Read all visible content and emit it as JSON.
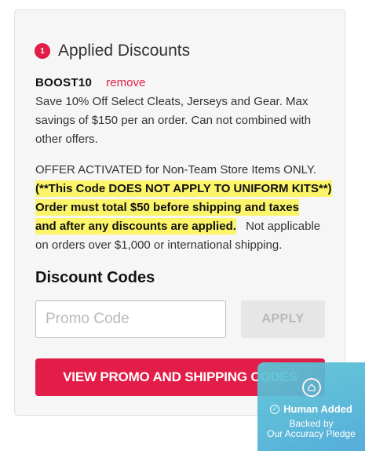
{
  "applied": {
    "count": "1",
    "title": "Applied Discounts",
    "code": "BOOST10",
    "remove_label": "remove",
    "description": "Save 10% Off Select Cleats, Jerseys and Gear. Max savings of $150 per an order. Can not combined with other offers.",
    "offer_plain": "OFFER ACTIVATED for Non-Team Store Items ONLY.",
    "offer_highlight_1": "(**This Code DOES NOT APPLY TO UNIFORM KITS**)",
    "offer_highlight_2": "Order must total $50 before shipping and taxes",
    "offer_highlight_3": "and after any discounts are applied.",
    "offer_tail": "Not applicable on orders over $1,000 or international shipping."
  },
  "discount_codes": {
    "heading": "Discount Codes",
    "placeholder": "Promo Code",
    "apply_label": "APPLY",
    "view_label": "VIEW PROMO AND SHIPPING CODES"
  },
  "pledge": {
    "title": "Human Added",
    "line1": "Backed by",
    "line2": "Our Accuracy Pledge"
  },
  "colors": {
    "accent": "#e11d48",
    "highlight": "#fcf56a",
    "pledge_bg": "#4aa8d8"
  },
  "icons": [
    "pledge-logo-icon",
    "check-circle-icon"
  ]
}
